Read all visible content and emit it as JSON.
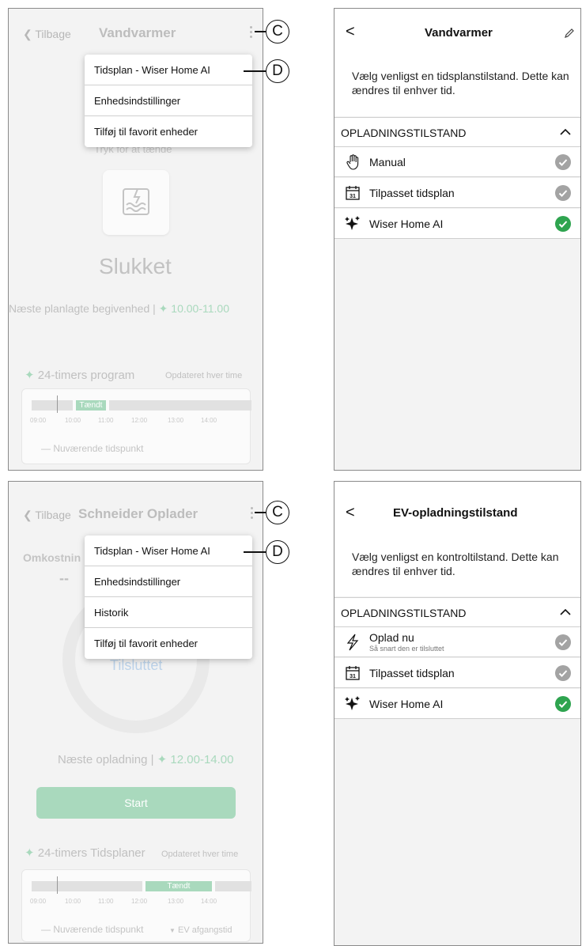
{
  "colors": {
    "accent_green": "#2ea44f",
    "muted_green": "#a9d9bd",
    "check_grey": "#a3a3a3"
  },
  "callouts": {
    "c": "C",
    "d": "D"
  },
  "screen1": {
    "back": "Tilbage",
    "title": "Vandvarmer",
    "menu": [
      "Tidsplan - Wiser Home AI",
      "Enhedsindstillinger",
      "Tilføj til favorit enheder"
    ],
    "hint": "Tryk for at tænde",
    "state": "Slukket",
    "next_event_label": "Næste planlagte begivenhed |",
    "next_event_time": "10.00-11.00",
    "program_title": "24-timers program",
    "program_updated": "Opdateret hver time",
    "bar_label": "Tændt",
    "ticks": [
      "09:00",
      "10:00",
      "11:00",
      "12:00",
      "13:00",
      "14:00"
    ],
    "legend": "— Nuværende tidspunkt"
  },
  "screen2": {
    "back": "Tilbage",
    "title": "Schneider Oplader",
    "cost_label": "Omkostnin",
    "cost_value": "--",
    "menu": [
      "Tidsplan - Wiser Home AI",
      "Enhedsindstillinger",
      "Historik",
      "Tilføj til favorit enheder"
    ],
    "status": "Tilsluttet",
    "next_charge_label": "Næste opladning |",
    "next_charge_time": "12.00-14.00",
    "start": "Start",
    "program_title": "24-timers Tidsplaner",
    "program_updated": "Opdateret hver time",
    "bar_label": "Tændt",
    "ticks": [
      "09:00",
      "10:00",
      "11:00",
      "12:00",
      "13:00",
      "14:00"
    ],
    "legend": "— Nuværende tidspunkt",
    "legend2": "EV afgangstid"
  },
  "screen3": {
    "back": "<",
    "title": "Vandvarmer",
    "description": "Vælg venligst en tidsplanstilstand. Dette kan ændres til enhver tid.",
    "section": "OPLADNINGSTILSTAND",
    "options": [
      {
        "label": "Manual",
        "icon": "hand-icon",
        "selected": false
      },
      {
        "label": "Tilpasset tidsplan",
        "icon": "calendar-icon",
        "selected": false
      },
      {
        "label": "Wiser Home AI",
        "icon": "sparkle-icon",
        "selected": true
      }
    ]
  },
  "screen4": {
    "back": "<",
    "title": "EV-opladningstilstand",
    "description": "Vælg venligst en kontroltilstand. Dette kan ændres til enhver tid.",
    "section": "OPLADNINGSTILSTAND",
    "options": [
      {
        "label": "Oplad nu",
        "sub": "Så snart den er tilsluttet",
        "icon": "lightning-icon",
        "selected": false
      },
      {
        "label": "Tilpasset tidsplan",
        "icon": "calendar-icon",
        "selected": false
      },
      {
        "label": "Wiser Home AI",
        "icon": "sparkle-icon",
        "selected": true
      }
    ]
  }
}
